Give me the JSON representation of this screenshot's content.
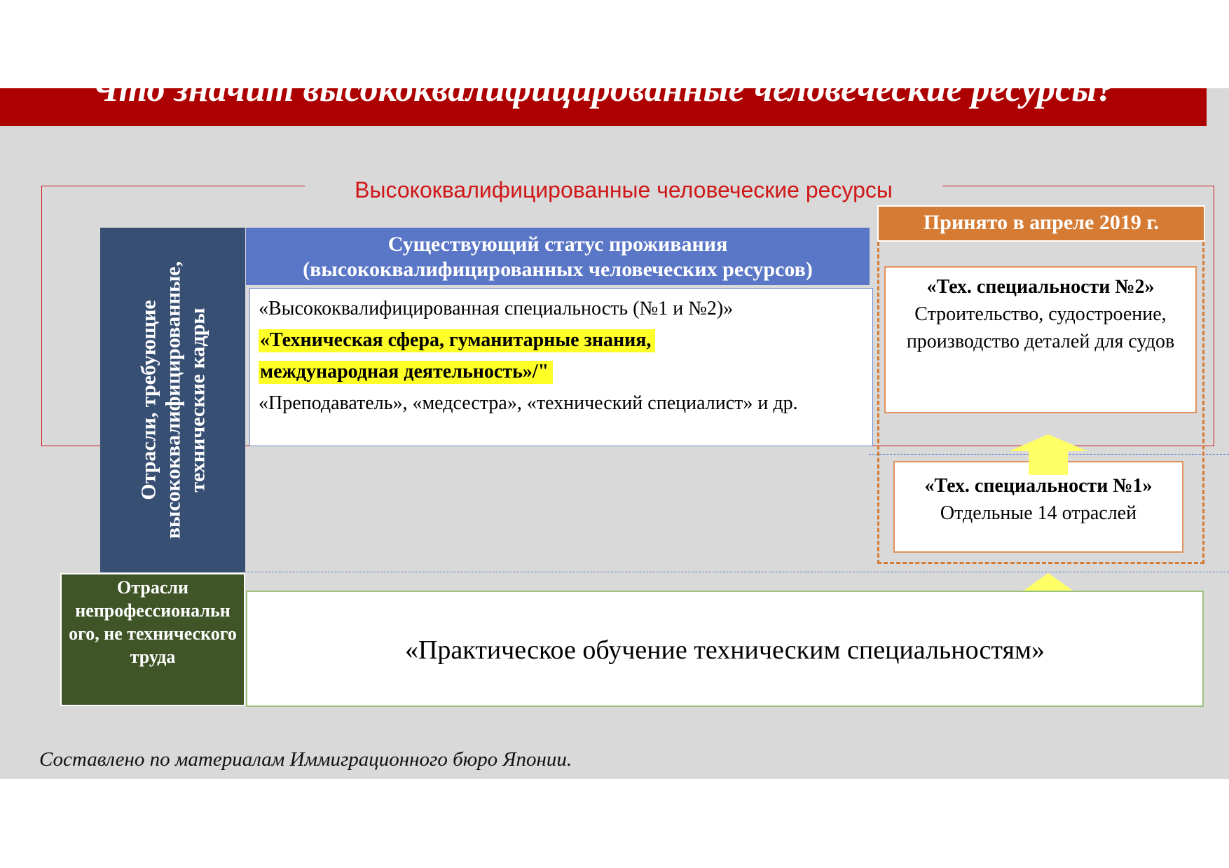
{
  "title": "Что значит высококвалифицированные человеческие ресурсы?",
  "frame_label": "Высококвалифицированные человеческие ресурсы",
  "left_column": {
    "vertical_label": "Отрасли, требующие высококвалифицированные, технические кадры",
    "green_label": "Отрасли непрофессиональн ого, не технического труда"
  },
  "status_header": {
    "line1": "Существующий статус проживания",
    "line2": "(высококвалифицированных человеческих ресурсов)"
  },
  "status_list": {
    "line1": "«Высококвалифицированная специальность (№1 и №2)»",
    "highlight1": "«Техническая сфера, гуманитарные знания,",
    "highlight2": "международная деятельность»/\"",
    "line4": "«Преподаватель», «медсестра», «технический специалист» и др."
  },
  "adopted_header": "Принято в апреле 2019 г.",
  "tech2": {
    "title": "«Тех. специальности №2»",
    "text": "Строительство, судостроение, производство деталей для судов"
  },
  "tech1": {
    "title": "«Тех. специальности №1»",
    "text": "Отдельные 14 отраслей"
  },
  "practical_training": "«Практическое обучение техническим специальностям»",
  "source": "Составлено по материалам Иммиграционного бюро Японии.",
  "colors": {
    "banner": "#ad0000",
    "navy": "#374f73",
    "green": "#3f5427",
    "blue_header": "#5a76c6",
    "orange": "#d57b33",
    "highlight": "#ffff28",
    "arrow": "#ffff66"
  }
}
